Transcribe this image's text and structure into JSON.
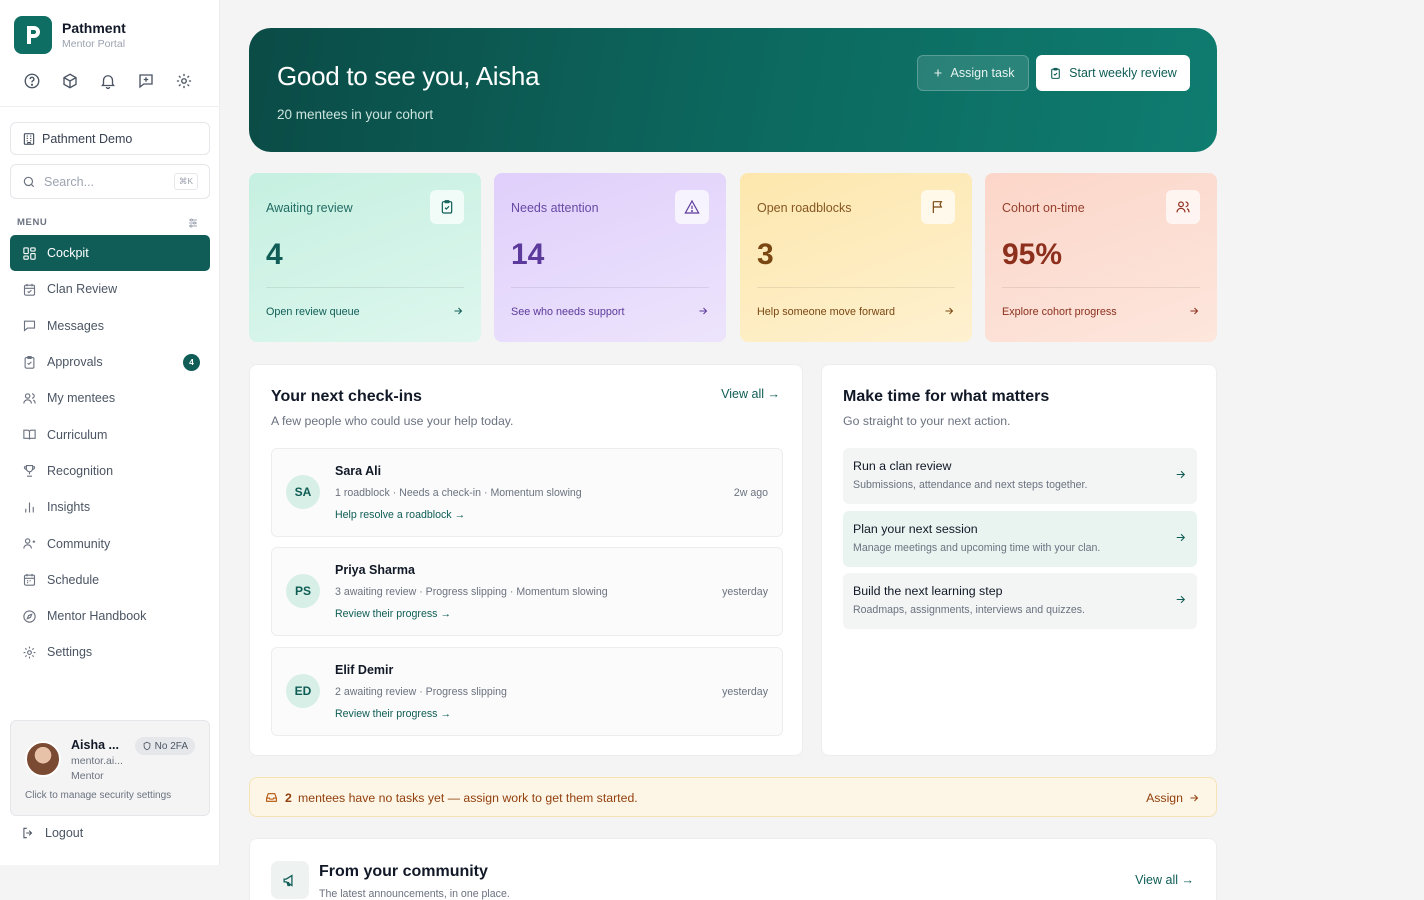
{
  "brand": {
    "name": "Pathment",
    "subtitle": "Mentor Portal"
  },
  "top_icons": [
    "help-icon",
    "box-icon",
    "bell-icon",
    "feedback-icon",
    "settings-gear-icon"
  ],
  "org": {
    "name": "Pathment Demo"
  },
  "search": {
    "placeholder": "Search...",
    "shortcut": "⌘K"
  },
  "menu": {
    "title": "MENU",
    "items": [
      {
        "label": "Cockpit",
        "icon": "dashboard-icon",
        "active": true
      },
      {
        "label": "Clan Review",
        "icon": "calendar-check-icon"
      },
      {
        "label": "Messages",
        "icon": "message-icon"
      },
      {
        "label": "Approvals",
        "icon": "clipboard-check-icon",
        "badge": "4"
      },
      {
        "label": "My mentees",
        "icon": "users-icon"
      },
      {
        "label": "Curriculum",
        "icon": "book-open-icon"
      },
      {
        "label": "Recognition",
        "icon": "trophy-icon"
      },
      {
        "label": "Insights",
        "icon": "bar-chart-icon"
      },
      {
        "label": "Community",
        "icon": "community-icon"
      },
      {
        "label": "Schedule",
        "icon": "calendar-icon"
      },
      {
        "label": "Mentor Handbook",
        "icon": "compass-icon"
      },
      {
        "label": "Settings",
        "icon": "settings-icon"
      }
    ]
  },
  "user": {
    "name": "Aisha ...",
    "email": "mentor.ai...",
    "role": "Mentor",
    "badge": "No 2FA",
    "manage": "Click to manage security settings",
    "logout": "Logout"
  },
  "hero": {
    "title": "Good to see you, Aisha",
    "subtitle": "20 mentees in your cohort",
    "assign_label": "Assign task",
    "weekly_label": "Start weekly review"
  },
  "stats": [
    {
      "label": "Awaiting review",
      "value": "4",
      "link": "Open review queue",
      "icon": "clipboard-check-icon"
    },
    {
      "label": "Needs attention",
      "value": "14",
      "link": "See who needs support",
      "icon": "warning-triangle-icon"
    },
    {
      "label": "Open roadblocks",
      "value": "3",
      "link": "Help someone move forward",
      "icon": "flag-icon"
    },
    {
      "label": "Cohort on-time",
      "value": "95%",
      "link": "Explore cohort progress",
      "icon": "users-icon"
    }
  ],
  "checkins": {
    "title": "Your next check-ins",
    "subtitle": "A few people who could use your help today.",
    "view_all": "View all →",
    "items": [
      {
        "initials": "SA",
        "name": "Sara Ali",
        "meta": "1 roadblock · Needs a check-in · Momentum slowing",
        "action": "Help resolve a roadblock →",
        "time": "2w ago"
      },
      {
        "initials": "PS",
        "name": "Priya Sharma",
        "meta": "3 awaiting review · Progress slipping · Momentum slowing",
        "action": "Review their progress →",
        "time": "yesterday"
      },
      {
        "initials": "ED",
        "name": "Elif Demir",
        "meta": "2 awaiting review · Progress slipping",
        "action": "Review their progress →",
        "time": "yesterday"
      }
    ]
  },
  "matters": {
    "title": "Make time for what matters",
    "subtitle": "Go straight to your next action.",
    "items": [
      {
        "title": "Run a clan review",
        "desc": "Submissions, attendance and next steps together."
      },
      {
        "title": "Plan your next session",
        "desc": "Manage meetings and upcoming time with your clan."
      },
      {
        "title": "Build the next learning step",
        "desc": "Roadmaps, assignments, interviews and quizzes."
      }
    ]
  },
  "banner": {
    "count": "2",
    "message": "mentees have no tasks yet — assign work to get them started.",
    "action": "Assign"
  },
  "community": {
    "title": "From your community",
    "subtitle": "The latest announcements, in one place.",
    "view_all": "View all →"
  },
  "colors": {
    "accent": "#0f5d56",
    "hero_start": "#0b4b46",
    "hero_end": "#0f7c70"
  }
}
